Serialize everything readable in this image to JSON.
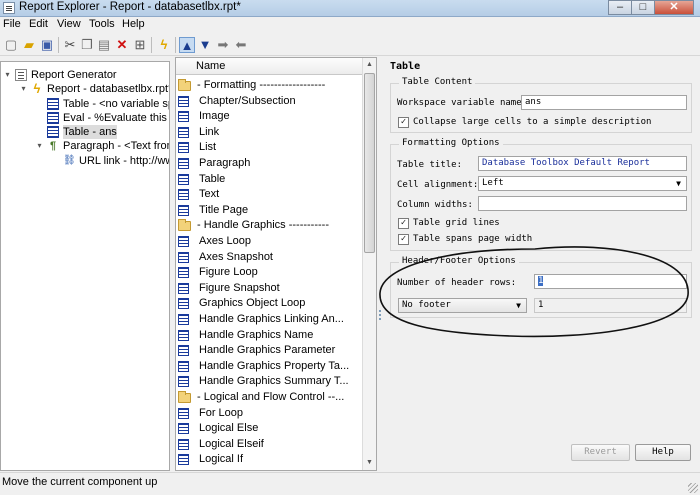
{
  "window": {
    "title": "Report Explorer - Report - databasetlbx.rpt*",
    "controls": [
      "–",
      "□",
      "✕"
    ]
  },
  "menu": [
    "File",
    "Edit",
    "View",
    "Tools",
    "Help"
  ],
  "toolbar": {
    "icons": [
      "new-icon",
      "open-icon",
      "save-icon",
      "cut-icon",
      "copy-icon",
      "paste-icon",
      "delete-icon",
      "import-icon",
      "run-icon",
      "move-up-icon",
      "move-down-icon",
      "move-right-icon",
      "move-left-icon"
    ]
  },
  "tree": {
    "items": [
      {
        "label": "Report Generator",
        "icon": "report-icon",
        "twisty": "▾",
        "level": 0
      },
      {
        "label": "Report - databasetlbx.rpt*",
        "icon": "bolt-icon",
        "twisty": "▾",
        "level": 1
      },
      {
        "label": "Table - <no variable speci",
        "icon": "table-icon",
        "twisty": "",
        "level": 2
      },
      {
        "label": "Eval - %Evaluate this strin",
        "icon": "table-icon",
        "twisty": "",
        "level": 2
      },
      {
        "label": "Table - ans",
        "icon": "table-icon",
        "twisty": "",
        "level": 2,
        "selected": true
      },
      {
        "label": "Paragraph - <Text from ch",
        "icon": "paragraph-icon",
        "twisty": "▾",
        "level": 2
      },
      {
        "label": "URL link - http://www.",
        "icon": "link-icon",
        "twisty": "",
        "level": 3
      }
    ]
  },
  "components": {
    "header": "Name",
    "items": [
      {
        "label": "- Formatting ------------------",
        "kind": "folder"
      },
      {
        "label": "Chapter/Subsection",
        "kind": "item"
      },
      {
        "label": "Image",
        "kind": "item"
      },
      {
        "label": "Link",
        "kind": "item"
      },
      {
        "label": "List",
        "kind": "item"
      },
      {
        "label": "Paragraph",
        "kind": "item"
      },
      {
        "label": "Table",
        "kind": "item"
      },
      {
        "label": "Text",
        "kind": "item"
      },
      {
        "label": "Title Page",
        "kind": "item"
      },
      {
        "label": "- Handle Graphics -----------",
        "kind": "folder"
      },
      {
        "label": "Axes Loop",
        "kind": "item"
      },
      {
        "label": "Axes Snapshot",
        "kind": "item"
      },
      {
        "label": "Figure Loop",
        "kind": "item"
      },
      {
        "label": "Figure Snapshot",
        "kind": "item"
      },
      {
        "label": "Graphics Object Loop",
        "kind": "item"
      },
      {
        "label": "Handle Graphics Linking An...",
        "kind": "item"
      },
      {
        "label": "Handle Graphics Name",
        "kind": "item"
      },
      {
        "label": "Handle Graphics Parameter",
        "kind": "item"
      },
      {
        "label": "Handle Graphics Property Ta...",
        "kind": "item"
      },
      {
        "label": "Handle Graphics Summary T...",
        "kind": "item"
      },
      {
        "label": "- Logical and Flow Control --...",
        "kind": "folder"
      },
      {
        "label": "For Loop",
        "kind": "item"
      },
      {
        "label": "Logical Else",
        "kind": "item"
      },
      {
        "label": "Logical Elseif",
        "kind": "item"
      },
      {
        "label": "Logical If",
        "kind": "item"
      }
    ]
  },
  "props": {
    "heading": "Table",
    "content": {
      "title": "Table Content",
      "workspace_label": "Workspace variable name:",
      "workspace_value": "ans",
      "collapse_label": "Collapse large cells to a simple description",
      "collapse_checked": true
    },
    "formatting": {
      "title": "Formatting Options",
      "table_title_label": "Table title:",
      "table_title_value": "Database Toolbox Default Report",
      "alignment_label": "Cell alignment:",
      "alignment_value": "Left",
      "column_widths_label": "Column widths:",
      "column_widths_value": "",
      "grid_lines_label": "Table grid lines",
      "grid_lines_checked": true,
      "spans_label": "Table spans page width",
      "spans_checked": true
    },
    "header_footer": {
      "title": "Header/Footer Options",
      "header_rows_label": "Number of header rows:",
      "header_rows_value": "1",
      "footer_option": "No footer",
      "footer_rows_value": "1"
    },
    "buttons": {
      "revert": "Revert",
      "help": "Help"
    }
  },
  "status": "Move the current component up"
}
